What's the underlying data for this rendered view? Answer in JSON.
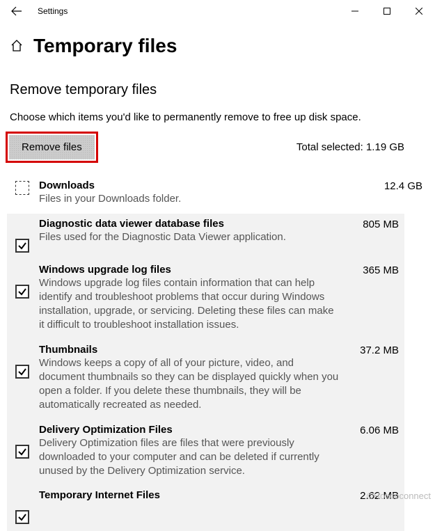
{
  "app_title": "Settings",
  "page_title": "Temporary files",
  "section_title": "Remove temporary files",
  "section_desc": "Choose which items you'd like to permanently remove to free up disk space.",
  "remove_button": "Remove files",
  "total_selected_label": "Total selected: 1.19 GB",
  "items": [
    {
      "title": "Downloads",
      "desc": "Files in your Downloads folder.",
      "size": "12.4 GB",
      "checked": false,
      "grouped": false
    },
    {
      "title": "Diagnostic data viewer database files",
      "desc": "Files used for the Diagnostic Data Viewer application.",
      "size": "805 MB",
      "checked": true,
      "grouped": true
    },
    {
      "title": "Windows upgrade log files",
      "desc": "Windows upgrade log files contain information that can help identify and troubleshoot problems that occur during Windows installation, upgrade, or servicing.  Deleting these files can make it difficult to troubleshoot installation issues.",
      "size": "365 MB",
      "checked": true,
      "grouped": true
    },
    {
      "title": "Thumbnails",
      "desc": "Windows keeps a copy of all of your picture, video, and document thumbnails so they can be displayed quickly when you open a folder. If you delete these thumbnails, they will be automatically recreated as needed.",
      "size": "37.2 MB",
      "checked": true,
      "grouped": true
    },
    {
      "title": "Delivery Optimization Files",
      "desc": "Delivery Optimization files are files that were previously downloaded to your computer and can be deleted if currently unused by the Delivery Optimization service.",
      "size": "6.06 MB",
      "checked": true,
      "grouped": true
    },
    {
      "title": "Temporary Internet Files",
      "desc": "",
      "size": "2.62 MB",
      "checked": true,
      "grouped": true
    }
  ],
  "watermark": "©Howtoconnect"
}
